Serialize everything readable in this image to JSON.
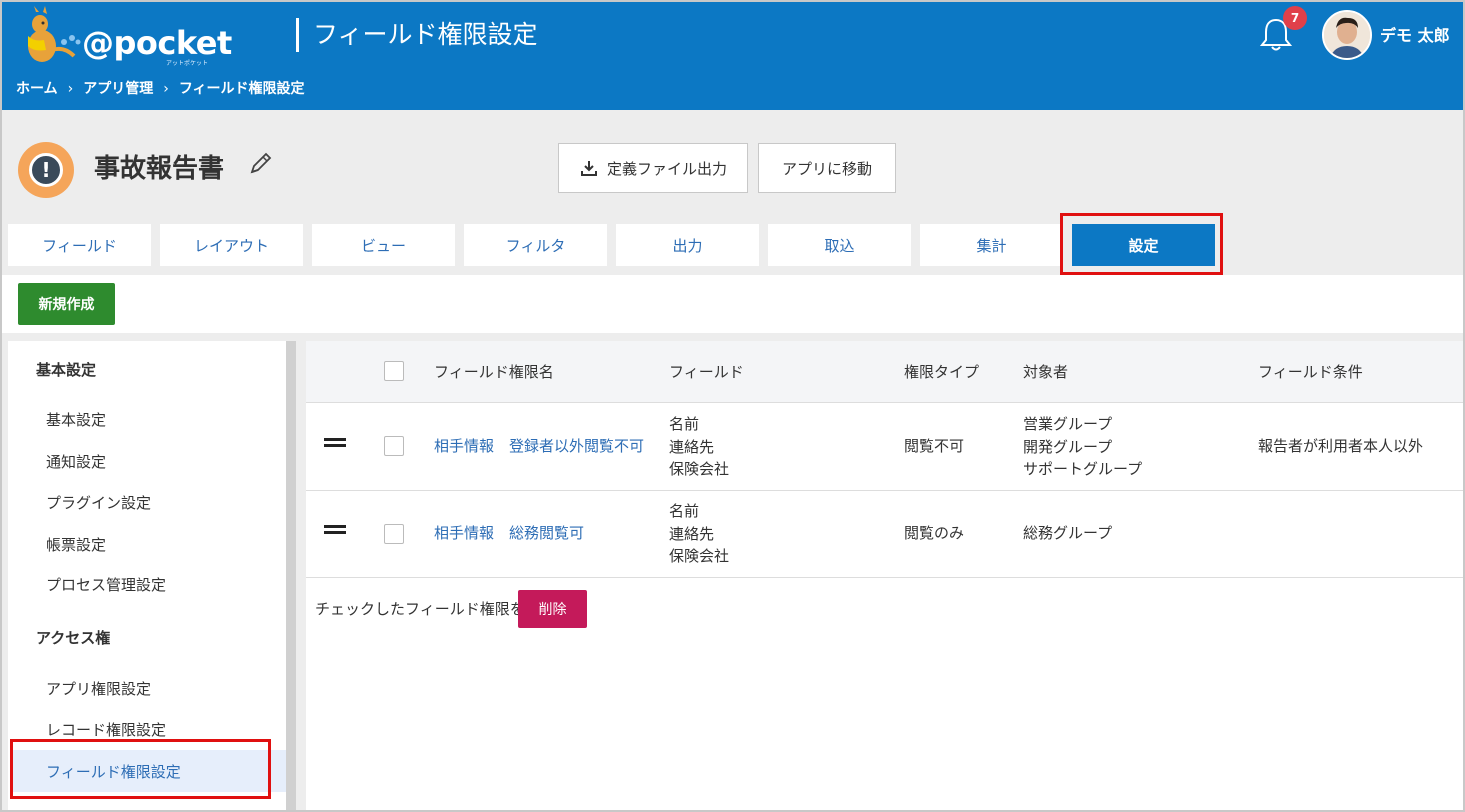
{
  "header": {
    "logo_text": "@pocket",
    "logo_sub": "アットポケット",
    "title": "フィールド権限設定",
    "breadcrumb": [
      "ホーム",
      "アプリ管理",
      "フィールド権限設定"
    ],
    "breadcrumb_sep": "›",
    "notification_count": "7",
    "user_name": "デモ 太郎"
  },
  "app": {
    "icon_glyph": "!",
    "title": "事故報告書",
    "export_label": "定義ファイル出力",
    "goto_label": "アプリに移動"
  },
  "tabs": [
    {
      "label": "フィールド"
    },
    {
      "label": "レイアウト"
    },
    {
      "label": "ビュー"
    },
    {
      "label": "フィルタ"
    },
    {
      "label": "出力"
    },
    {
      "label": "取込"
    },
    {
      "label": "集計"
    },
    {
      "label": "設定",
      "active": true
    }
  ],
  "new_button_label": "新規作成",
  "sidebar": {
    "sections": [
      {
        "heading": "基本設定",
        "items": [
          "基本設定",
          "通知設定",
          "プラグイン設定",
          "帳票設定",
          "プロセス管理設定"
        ]
      },
      {
        "heading": "アクセス権",
        "items": [
          "アプリ権限設定",
          "レコード権限設定",
          "フィールド権限設定"
        ]
      }
    ],
    "active_item": "フィールド権限設定"
  },
  "table": {
    "columns": [
      "フィールド権限名",
      "フィールド",
      "権限タイプ",
      "対象者",
      "フィールド条件"
    ],
    "rows": [
      {
        "name": "相手情報　登録者以外閲覧不可",
        "fields": [
          "名前",
          "連絡先",
          "保険会社"
        ],
        "permission_type": "閲覧不可",
        "targets": [
          "営業グループ",
          "開発グループ",
          "サポートグループ"
        ],
        "condition": "報告者が利用者本人以外"
      },
      {
        "name": "相手情報　総務閲覧可",
        "fields": [
          "名前",
          "連絡先",
          "保険会社"
        ],
        "permission_type": "閲覧のみ",
        "targets": [
          "総務グループ"
        ],
        "condition": ""
      }
    ]
  },
  "footer": {
    "text": "チェックしたフィールド権限を",
    "delete_label": "削除"
  },
  "colors": {
    "brand_blue": "#0c78c4",
    "link_blue": "#2d6db5",
    "new_green": "#2e8b2e",
    "delete_red": "#c41a5a",
    "highlight_red": "#e01010",
    "badge_red": "#e0404a"
  }
}
